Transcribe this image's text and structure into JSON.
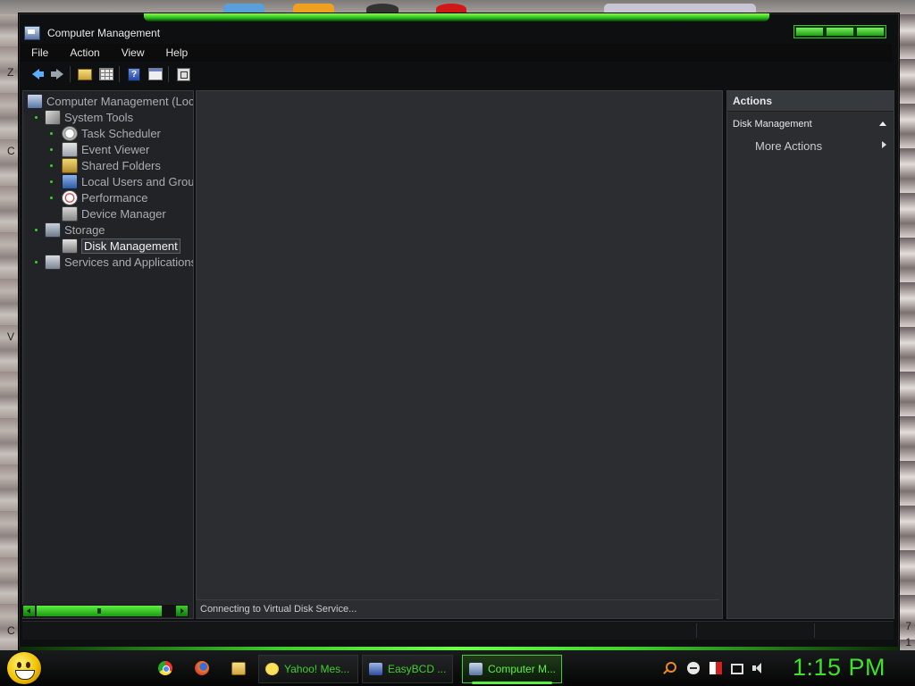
{
  "window": {
    "title": "Computer Management"
  },
  "menubar": {
    "items": [
      "File",
      "Action",
      "View",
      "Help"
    ]
  },
  "toolbar": {
    "buttons": [
      {
        "icon": "back-arrow-icon"
      },
      {
        "icon": "forward-arrow-icon"
      },
      {
        "icon": "folder-up-icon"
      },
      {
        "icon": "show-hide-tree-icon"
      },
      {
        "icon": "help-icon"
      },
      {
        "icon": "show-hide-action-pane-icon"
      },
      {
        "icon": "properties-icon"
      }
    ]
  },
  "tree": {
    "root": "Computer Management (Loc",
    "system_tools": "System Tools",
    "task_scheduler": "Task Scheduler",
    "event_viewer": "Event Viewer",
    "shared_folders": "Shared Folders",
    "local_users": "Local Users and Grou",
    "performance": "Performance",
    "device_manager": "Device Manager",
    "storage": "Storage",
    "disk_management": "Disk Management",
    "services": "Services and Applications"
  },
  "content": {
    "status": "Connecting to Virtual Disk Service..."
  },
  "actions": {
    "header": "Actions",
    "section": "Disk Management",
    "more_actions": "More Actions"
  },
  "taskbar": {
    "tasks": [
      {
        "label": "Yahoo! Mes..."
      },
      {
        "label": "EasyBCD ..."
      },
      {
        "label": "Computer M..."
      }
    ],
    "clock": "1:15 PM"
  },
  "desktop": {
    "left_letters": [
      "Z",
      "C",
      "V",
      "C"
    ],
    "right_letters": [
      "7",
      "1"
    ]
  },
  "colors": {
    "accent": "#3fd02b",
    "pane_bg": "#2b2d31",
    "window_bg": "#0e0f10"
  }
}
